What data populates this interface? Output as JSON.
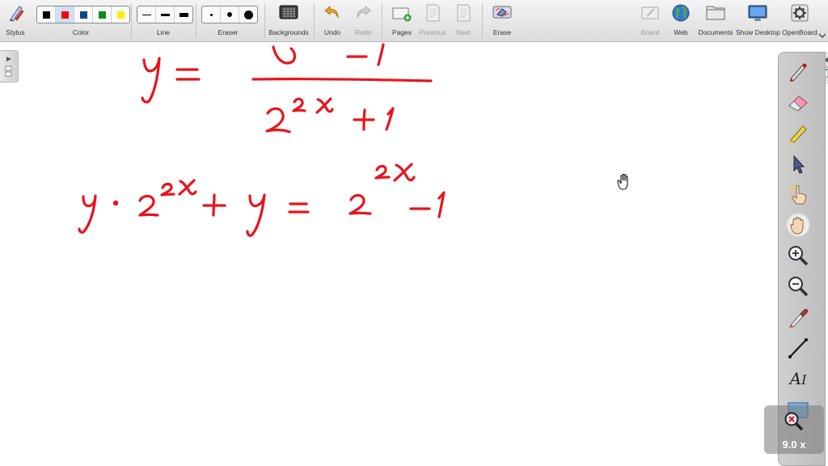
{
  "toolbar": {
    "stylus_label": "Stylus",
    "color_label": "Color",
    "line_label": "Line",
    "eraser_label": "Eraser",
    "backgrounds_label": "Backgrounds",
    "undo_label": "Undo",
    "redo_label": "Redo",
    "pages_label": "Pages",
    "previous_label": "Previous",
    "next_label": "Next",
    "erase_label": "Erase",
    "board_label": "Board",
    "web_label": "Web",
    "documents_label": "Documents",
    "show_desktop_label": "Show Desktop",
    "openboard_label": "OpenBoard"
  },
  "colors": {
    "palette": [
      "#000000",
      "#ff0000",
      "#0b4a8b",
      "#0f8a1a",
      "#ffee00"
    ],
    "selected_index": 1,
    "ink": "#e8141b"
  },
  "zoom": {
    "level": "9.0 x"
  },
  "dock": {
    "tools": [
      "pen-icon",
      "eraser-icon",
      "marker-icon",
      "selector-arrow-icon",
      "laser-pointer-icon",
      "hand-icon",
      "zoom-in-icon",
      "zoom-out-icon",
      "pipette-icon",
      "line-icon",
      "text-icon",
      "capture-icon"
    ],
    "selected_tool": "hand-icon",
    "text_tool_glyph": "A",
    "text_tool_cursor": "I"
  }
}
